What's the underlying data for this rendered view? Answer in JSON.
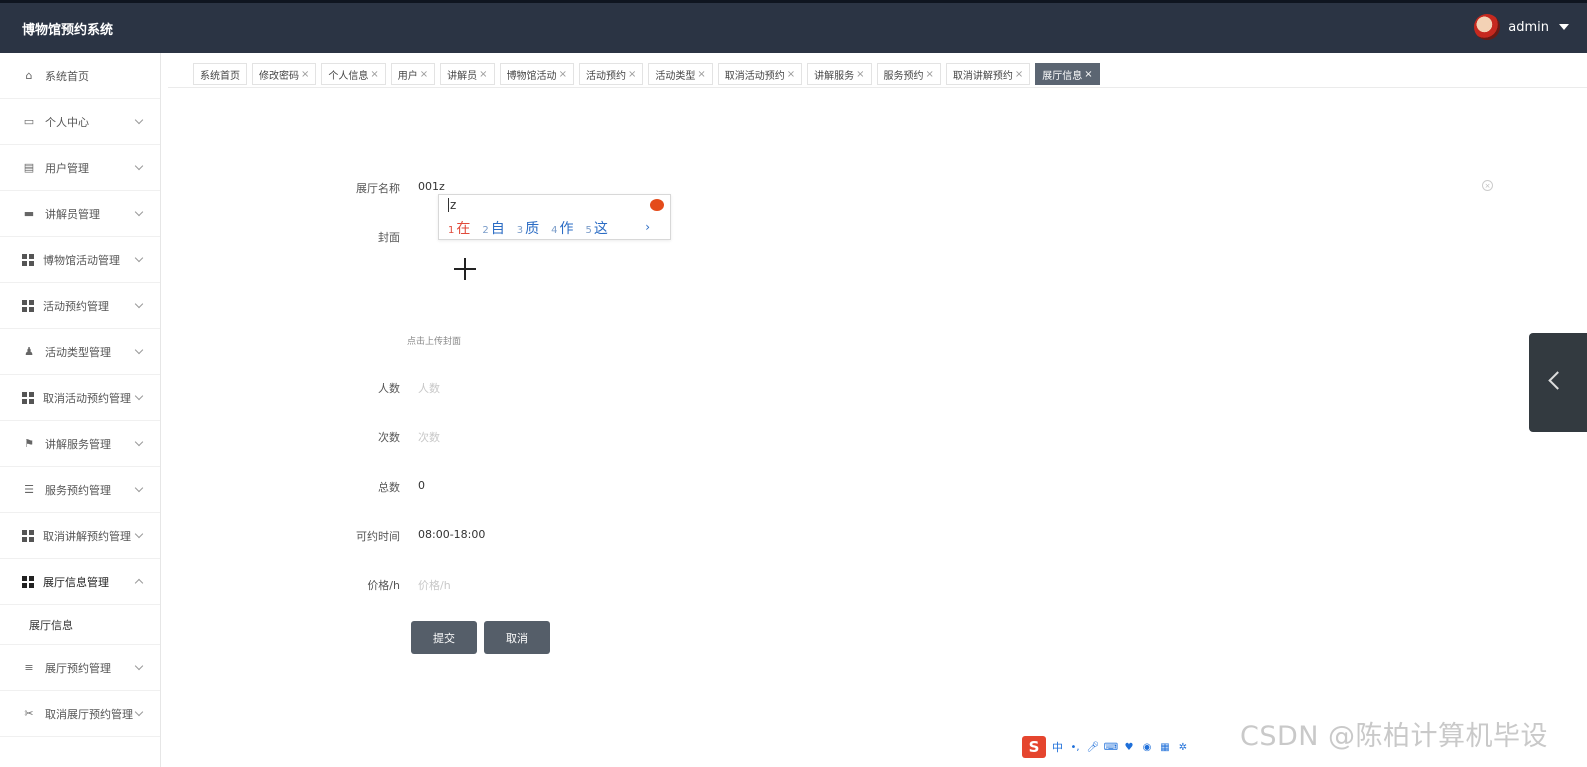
{
  "header": {
    "app_title": "博物馆预约系统",
    "user_name": "admin"
  },
  "sidebar": {
    "items": [
      {
        "label": "系统首页",
        "icon": "home-icon",
        "expandable": false
      },
      {
        "label": "个人中心",
        "icon": "card-icon",
        "expandable": true
      },
      {
        "label": "用户管理",
        "icon": "clipboard-icon",
        "expandable": true
      },
      {
        "label": "讲解员管理",
        "icon": "chat-icon",
        "expandable": true
      },
      {
        "label": "博物馆活动管理",
        "icon": "grid-icon",
        "expandable": true
      },
      {
        "label": "活动预约管理",
        "icon": "grid-icon",
        "expandable": true
      },
      {
        "label": "活动类型管理",
        "icon": "user-stamp-icon",
        "expandable": true
      },
      {
        "label": "取消活动预约管理",
        "icon": "grid-icon",
        "expandable": true
      },
      {
        "label": "讲解服务管理",
        "icon": "flag-icon",
        "expandable": true
      },
      {
        "label": "服务预约管理",
        "icon": "sliders-icon",
        "expandable": true
      },
      {
        "label": "取消讲解预约管理",
        "icon": "grid-icon",
        "expandable": true
      },
      {
        "label": "展厅信息管理",
        "icon": "grid-icon",
        "expandable": true,
        "expanded": true
      },
      {
        "label": "展厅预约管理",
        "icon": "list-icon",
        "expandable": true
      },
      {
        "label": "取消展厅预约管理",
        "icon": "ticket-icon",
        "expandable": true
      }
    ],
    "submenu_label": "展厅信息"
  },
  "tabs": [
    {
      "label": "系统首页",
      "closable": false
    },
    {
      "label": "修改密码",
      "closable": true
    },
    {
      "label": "个人信息",
      "closable": true
    },
    {
      "label": "用户",
      "closable": true
    },
    {
      "label": "讲解员",
      "closable": true
    },
    {
      "label": "博物馆活动",
      "closable": true
    },
    {
      "label": "活动预约",
      "closable": true
    },
    {
      "label": "活动类型",
      "closable": true
    },
    {
      "label": "取消活动预约",
      "closable": true
    },
    {
      "label": "讲解服务",
      "closable": true
    },
    {
      "label": "服务预约",
      "closable": true
    },
    {
      "label": "取消讲解预约",
      "closable": true
    },
    {
      "label": "展厅信息",
      "closable": true,
      "active": true
    }
  ],
  "tab_close_glyph": "×",
  "form": {
    "hall_name_label": "展厅名称",
    "hall_name_value": "001z",
    "cover_label": "封面",
    "cover_hint": "点击上传封面",
    "people_label": "人数",
    "people_placeholder": "人数",
    "times_label": "次数",
    "times_placeholder": "次数",
    "total_label": "总数",
    "total_value": "0",
    "available_time_label": "可约时间",
    "available_time_value": "08:00-18:00",
    "price_label": "价格/h",
    "price_placeholder": "价格/h",
    "submit_label": "提交",
    "cancel_label": "取消"
  },
  "ime": {
    "composition": "z",
    "candidates": [
      {
        "num": "1",
        "char": "在"
      },
      {
        "num": "2",
        "char": "自"
      },
      {
        "num": "3",
        "char": "质"
      },
      {
        "num": "4",
        "char": "作"
      },
      {
        "num": "5",
        "char": "这"
      }
    ],
    "next_glyph": "›",
    "toolbar_logo": "S",
    "toolbar_mode": "中"
  },
  "watermark": "CSDN @陈柏计算机毕设",
  "colors": {
    "topbar": "#2b3444",
    "active_tab": "#5b6572",
    "button": "#555e69",
    "ime_red": "#e5452e"
  }
}
